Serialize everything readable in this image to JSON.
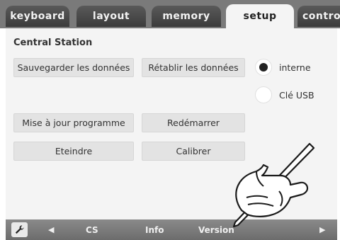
{
  "tabs": [
    {
      "label": "keyboard"
    },
    {
      "label": "layout"
    },
    {
      "label": "memory"
    },
    {
      "label": "setup"
    },
    {
      "label": "control"
    }
  ],
  "active_tab": "setup",
  "section": {
    "title": "Central Station"
  },
  "buttons": {
    "save": "Sauvegarder les données",
    "restore": "Rétablir les données",
    "update": "Mise à jour programme",
    "restart": "Redémarrer",
    "shutdown": "Eteindre",
    "calibrate": "Calibrer"
  },
  "storage": {
    "options": [
      {
        "label": "interne",
        "selected": true
      },
      {
        "label": "Clé USB",
        "selected": false
      }
    ]
  },
  "bottom": {
    "items": [
      "CS",
      "Info",
      "Version"
    ],
    "wrench_icon": "wrench-icon",
    "left_icon": "arrow-left-icon",
    "right_icon": "arrow-right-icon"
  },
  "colors": {
    "tabbar": "#7a7a7a",
    "tab": "#4a4a4a",
    "active_tab": "#f4f4f4",
    "content": "#f4f4f4",
    "button": "#e3e3e3",
    "bottombar": "#7c7c7c"
  }
}
